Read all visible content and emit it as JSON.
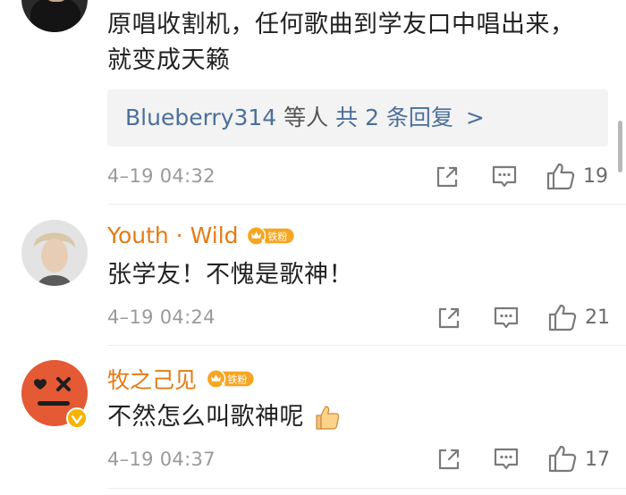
{
  "comments": [
    {
      "text_line1": "原唱收割机，任何歌曲到学友口中唱出来，",
      "text_line2": "就变成天籁",
      "replies": {
        "user": "Blueberry314",
        "middle": "等人",
        "count_text": "共 2 条回复",
        "arrow": ">"
      },
      "time": "4–19 04:32",
      "likes": "19"
    },
    {
      "username": "Youth · Wild",
      "badge": "铁粉",
      "badge_level": "5",
      "text": "张学友！不愧是歌神！",
      "time": "4–19 04:24",
      "likes": "21"
    },
    {
      "username": "牧之己见",
      "badge": "铁粉",
      "badge_level": "5",
      "text": "不然怎么叫歌神呢",
      "time": "4–19 04:37",
      "likes": "17"
    }
  ],
  "colors": {
    "username": "#e57a14",
    "reply_link": "#4a6f9c",
    "meta_gray": "#9a9a9a",
    "badge_orange": "#f6a623"
  },
  "icons": [
    "share-icon",
    "comment-icon",
    "like-icon",
    "thumbs-up-emoji",
    "verified-badge-icon",
    "fan-badge-icon"
  ]
}
